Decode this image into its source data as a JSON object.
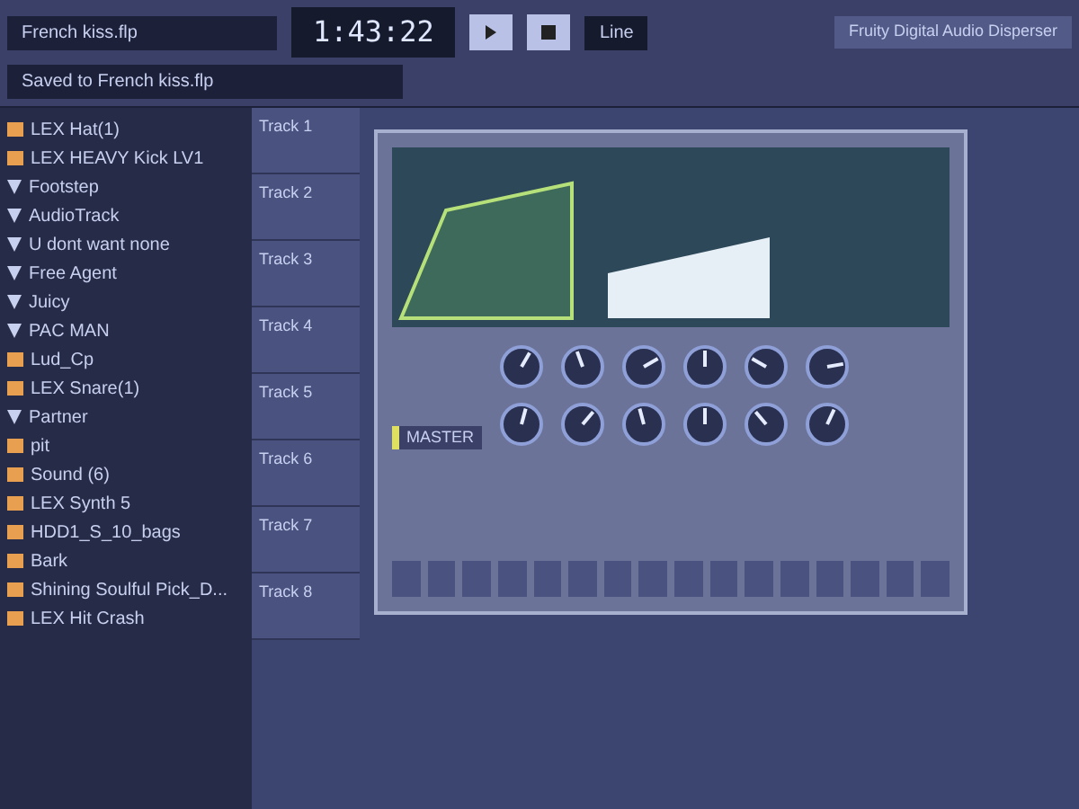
{
  "transport": {
    "time": "1:43:22",
    "mode": "Line",
    "hint": "Saved to French kiss.flp",
    "file": "French kiss.flp",
    "plugin_picker": "Fruity Digital Audio Disperser"
  },
  "browser": {
    "items": [
      {
        "label": "LEX Hat(1)",
        "kind": "file"
      },
      {
        "label": "LEX HEAVY Kick LV1",
        "kind": "file"
      },
      {
        "label": "Footstep",
        "kind": "plugin"
      },
      {
        "label": "AudioTrack",
        "kind": "plugin"
      },
      {
        "label": "U dont want none",
        "kind": "plugin"
      },
      {
        "label": "Free Agent",
        "kind": "plugin"
      },
      {
        "label": "Juicy",
        "kind": "plugin"
      },
      {
        "label": "PAC MAN",
        "kind": "plugin"
      },
      {
        "label": "Lud_Cp",
        "kind": "file"
      },
      {
        "label": "LEX Snare(1)",
        "kind": "file"
      },
      {
        "label": "Partner",
        "kind": "plugin"
      },
      {
        "label": "pit",
        "kind": "file"
      },
      {
        "label": "Sound (6)",
        "kind": "file"
      },
      {
        "label": "LEX Synth 5",
        "kind": "file"
      },
      {
        "label": "HDD1_S_10_bags",
        "kind": "file"
      },
      {
        "label": "Bark",
        "kind": "file"
      },
      {
        "label": "Shining Soulful Pick_D...",
        "kind": "file"
      },
      {
        "label": "LEX Hit Crash",
        "kind": "file"
      }
    ]
  },
  "tracks": [
    "Track 1",
    "Track 2",
    "Track 3",
    "Track 4",
    "Track 5",
    "Track 6",
    "Track 7",
    "Track 8"
  ],
  "plugin": {
    "master_label": "MASTER"
  },
  "steps": [
    {
      "on": false
    },
    {
      "on": false
    },
    {
      "on": false
    },
    {
      "on": false
    },
    {
      "on": false
    },
    {
      "on": false
    },
    {
      "on": false
    },
    {
      "on": false
    },
    {
      "on": false
    },
    {
      "on": false
    },
    {
      "on": false
    },
    {
      "on": false
    },
    {
      "on": false
    },
    {
      "on": false
    },
    {
      "on": false
    },
    {
      "on": false
    }
  ]
}
